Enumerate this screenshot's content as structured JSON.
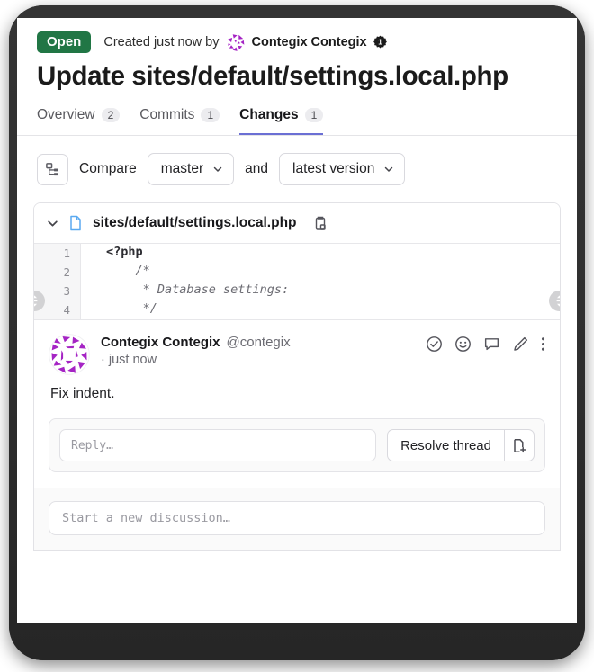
{
  "header": {
    "state_badge": "Open",
    "created_text": "Created just now by",
    "author_name": "Contegix Contegix",
    "owner_badge_number": "1",
    "title": "Update sites/default/settings.local.php"
  },
  "tabs": [
    {
      "label": "Overview",
      "count": "2",
      "active": false
    },
    {
      "label": "Commits",
      "count": "1",
      "active": false
    },
    {
      "label": "Changes",
      "count": "1",
      "active": true
    }
  ],
  "compare": {
    "tree_icon": "tree-icon",
    "label": "Compare",
    "source": "master",
    "conjunction": "and",
    "target": "latest version",
    "chevron_icon": "chevron-down-icon"
  },
  "diff": {
    "collapse_icon": "chevron-down-icon",
    "file_icon": "file-icon",
    "filename": "sites/default/settings.local.php",
    "copy_icon": "copy-icon",
    "lines": [
      {
        "number": "1",
        "text": "<?php",
        "style": "kw"
      },
      {
        "number": "2",
        "text": "    /*",
        "style": "cm"
      },
      {
        "number": "3",
        "text": "     * Database settings:",
        "style": "cm"
      },
      {
        "number": "4",
        "text": "     */",
        "style": "cm"
      }
    ],
    "expand_handle_icon": "expand-vertical-icon"
  },
  "comment": {
    "avatar": "identicon-avatar",
    "author_name": "Contegix Contegix",
    "author_handle": "@contegix",
    "timestamp": "· just now",
    "body": "Fix indent.",
    "actions": [
      {
        "name": "resolve-check-icon"
      },
      {
        "name": "emoji-icon"
      },
      {
        "name": "comment-icon"
      },
      {
        "name": "edit-pencil-icon"
      },
      {
        "name": "more-options-icon"
      }
    ]
  },
  "reply": {
    "placeholder": "Reply…",
    "value": "",
    "resolve_label": "Resolve thread",
    "file_icon": "file-plus-icon"
  },
  "new_discussion": {
    "placeholder": "Start a new discussion…",
    "value": ""
  },
  "colors": {
    "state_green": "#217645",
    "accent_purple": "#6b6fd4",
    "identicon_purple": "#a524c4",
    "file_icon_blue": "#5aa9f0"
  }
}
